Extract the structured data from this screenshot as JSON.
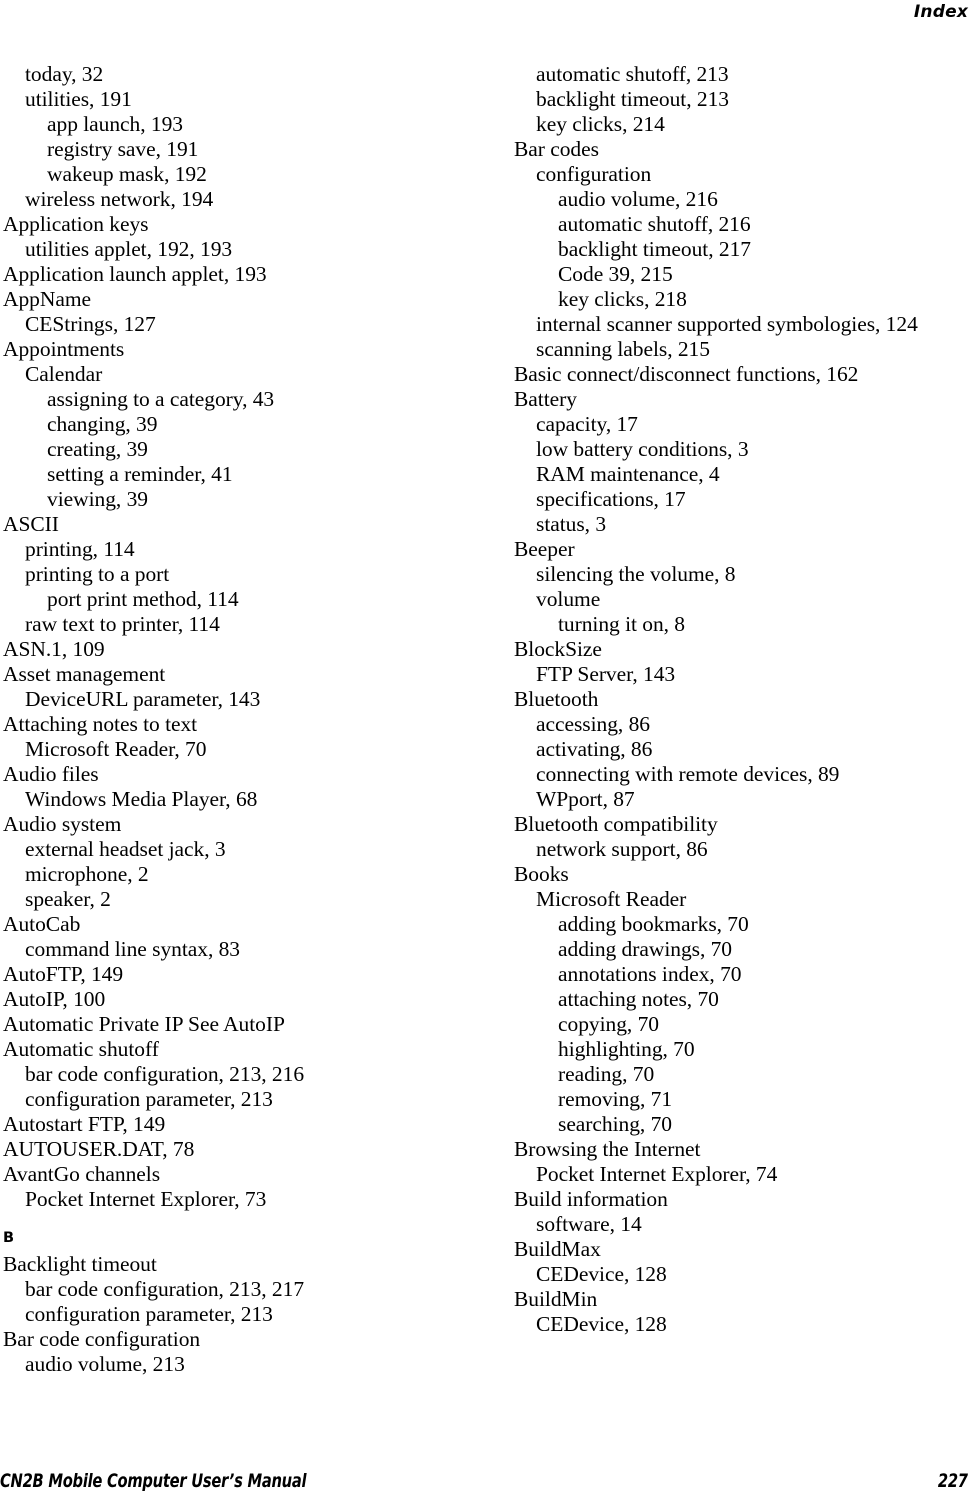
{
  "header": {
    "title": "Index"
  },
  "footer": {
    "manual_title": "CN2B Mobile Computer User’s Manual",
    "page_number": "227"
  },
  "index": {
    "columns": [
      {
        "name": "left-column",
        "blocks": [
          {
            "type": "entries",
            "entries": [
              {
                "level": 1,
                "text": "today, 32"
              },
              {
                "level": 1,
                "text": "utilities, 191"
              },
              {
                "level": 2,
                "text": "app launch, 193"
              },
              {
                "level": 2,
                "text": "registry save, 191"
              },
              {
                "level": 2,
                "text": "wakeup mask, 192"
              },
              {
                "level": 1,
                "text": "wireless network, 194"
              },
              {
                "level": 0,
                "text": "Application keys"
              },
              {
                "level": 1,
                "text": "utilities applet, 192, 193"
              },
              {
                "level": 0,
                "text": "Application launch applet, 193"
              },
              {
                "level": 0,
                "text": "AppName"
              },
              {
                "level": 1,
                "text": "CEStrings, 127"
              },
              {
                "level": 0,
                "text": "Appointments"
              },
              {
                "level": 1,
                "text": "Calendar"
              },
              {
                "level": 2,
                "text": "assigning to a category, 43"
              },
              {
                "level": 2,
                "text": "changing, 39"
              },
              {
                "level": 2,
                "text": "creating, 39"
              },
              {
                "level": 2,
                "text": "setting a reminder, 41"
              },
              {
                "level": 2,
                "text": "viewing, 39"
              },
              {
                "level": 0,
                "text": "ASCII"
              },
              {
                "level": 1,
                "text": "printing, 114"
              },
              {
                "level": 1,
                "text": "printing to a port"
              },
              {
                "level": 2,
                "text": "port print method, 114"
              },
              {
                "level": 1,
                "text": "raw text to printer, 114"
              },
              {
                "level": 0,
                "text": "ASN.1, 109"
              },
              {
                "level": 0,
                "text": "Asset management"
              },
              {
                "level": 1,
                "text": "DeviceURL parameter, 143"
              },
              {
                "level": 0,
                "text": "Attaching notes to text"
              },
              {
                "level": 1,
                "text": "Microsoft Reader, 70"
              },
              {
                "level": 0,
                "text": "Audio files"
              },
              {
                "level": 1,
                "text": "Windows Media Player, 68"
              },
              {
                "level": 0,
                "text": "Audio system"
              },
              {
                "level": 1,
                "text": "external headset jack, 3"
              },
              {
                "level": 1,
                "text": "microphone, 2"
              },
              {
                "level": 1,
                "text": "speaker, 2"
              },
              {
                "level": 0,
                "text": "AutoCab"
              },
              {
                "level": 1,
                "text": "command line syntax, 83"
              },
              {
                "level": 0,
                "text": "AutoFTP, 149"
              },
              {
                "level": 0,
                "text": "AutoIP, 100"
              },
              {
                "level": 0,
                "text": "Automatic Private IP See AutoIP"
              },
              {
                "level": 0,
                "text": "Automatic shutoff"
              },
              {
                "level": 1,
                "text": "bar code configuration, 213, 216"
              },
              {
                "level": 1,
                "text": "configuration parameter, 213"
              },
              {
                "level": 0,
                "text": "Autostart FTP, 149"
              },
              {
                "level": 0,
                "text": "AUTOUSER.DAT, 78"
              },
              {
                "level": 0,
                "text": "AvantGo channels"
              },
              {
                "level": 1,
                "text": "Pocket Internet Explorer, 73"
              }
            ]
          },
          {
            "type": "section-letter",
            "letter": "B"
          },
          {
            "type": "entries",
            "entries": [
              {
                "level": 0,
                "text": "Backlight timeout"
              },
              {
                "level": 1,
                "text": "bar code configuration, 213, 217"
              },
              {
                "level": 1,
                "text": "configuration parameter, 213"
              },
              {
                "level": 0,
                "text": "Bar code configuration"
              },
              {
                "level": 1,
                "text": "audio volume, 213"
              }
            ]
          }
        ]
      },
      {
        "name": "right-column",
        "blocks": [
          {
            "type": "entries",
            "entries": [
              {
                "level": 1,
                "text": "automatic shutoff, 213"
              },
              {
                "level": 1,
                "text": "backlight timeout, 213"
              },
              {
                "level": 1,
                "text": "key clicks, 214"
              },
              {
                "level": 0,
                "text": "Bar codes"
              },
              {
                "level": 1,
                "text": "configuration"
              },
              {
                "level": 2,
                "text": "audio volume, 216"
              },
              {
                "level": 2,
                "text": "automatic shutoff, 216"
              },
              {
                "level": 2,
                "text": "backlight timeout, 217"
              },
              {
                "level": 2,
                "text": "Code 39, 215"
              },
              {
                "level": 2,
                "text": "key clicks, 218"
              },
              {
                "level": 1,
                "text": "internal scanner supported symbologies, 124"
              },
              {
                "level": 1,
                "text": "scanning labels, 215"
              },
              {
                "level": 0,
                "text": "Basic connect/disconnect functions, 162"
              },
              {
                "level": 0,
                "text": "Battery"
              },
              {
                "level": 1,
                "text": "capacity, 17"
              },
              {
                "level": 1,
                "text": "low battery conditions, 3"
              },
              {
                "level": 1,
                "text": "RAM maintenance, 4"
              },
              {
                "level": 1,
                "text": "specifications, 17"
              },
              {
                "level": 1,
                "text": "status, 3"
              },
              {
                "level": 0,
                "text": "Beeper"
              },
              {
                "level": 1,
                "text": "silencing the volume, 8"
              },
              {
                "level": 1,
                "text": "volume"
              },
              {
                "level": 2,
                "text": "turning it on, 8"
              },
              {
                "level": 0,
                "text": "BlockSize"
              },
              {
                "level": 1,
                "text": "FTP Server, 143"
              },
              {
                "level": 0,
                "text": "Bluetooth"
              },
              {
                "level": 1,
                "text": "accessing, 86"
              },
              {
                "level": 1,
                "text": "activating, 86"
              },
              {
                "level": 1,
                "text": "connecting with remote devices, 89"
              },
              {
                "level": 1,
                "text": "WPport, 87"
              },
              {
                "level": 0,
                "text": "Bluetooth compatibility"
              },
              {
                "level": 1,
                "text": "network support, 86"
              },
              {
                "level": 0,
                "text": "Books"
              },
              {
                "level": 1,
                "text": "Microsoft Reader"
              },
              {
                "level": 2,
                "text": "adding bookmarks, 70"
              },
              {
                "level": 2,
                "text": "adding drawings, 70"
              },
              {
                "level": 2,
                "text": "annotations index, 70"
              },
              {
                "level": 2,
                "text": "attaching notes, 70"
              },
              {
                "level": 2,
                "text": "copying, 70"
              },
              {
                "level": 2,
                "text": "highlighting, 70"
              },
              {
                "level": 2,
                "text": "reading, 70"
              },
              {
                "level": 2,
                "text": "removing, 71"
              },
              {
                "level": 2,
                "text": "searching, 70"
              },
              {
                "level": 0,
                "text": "Browsing the Internet"
              },
              {
                "level": 1,
                "text": "Pocket Internet Explorer, 74"
              },
              {
                "level": 0,
                "text": "Build information"
              },
              {
                "level": 1,
                "text": "software, 14"
              },
              {
                "level": 0,
                "text": "BuildMax"
              },
              {
                "level": 1,
                "text": "CEDevice, 128"
              },
              {
                "level": 0,
                "text": "BuildMin"
              },
              {
                "level": 1,
                "text": "CEDevice, 128"
              }
            ]
          }
        ]
      }
    ]
  }
}
